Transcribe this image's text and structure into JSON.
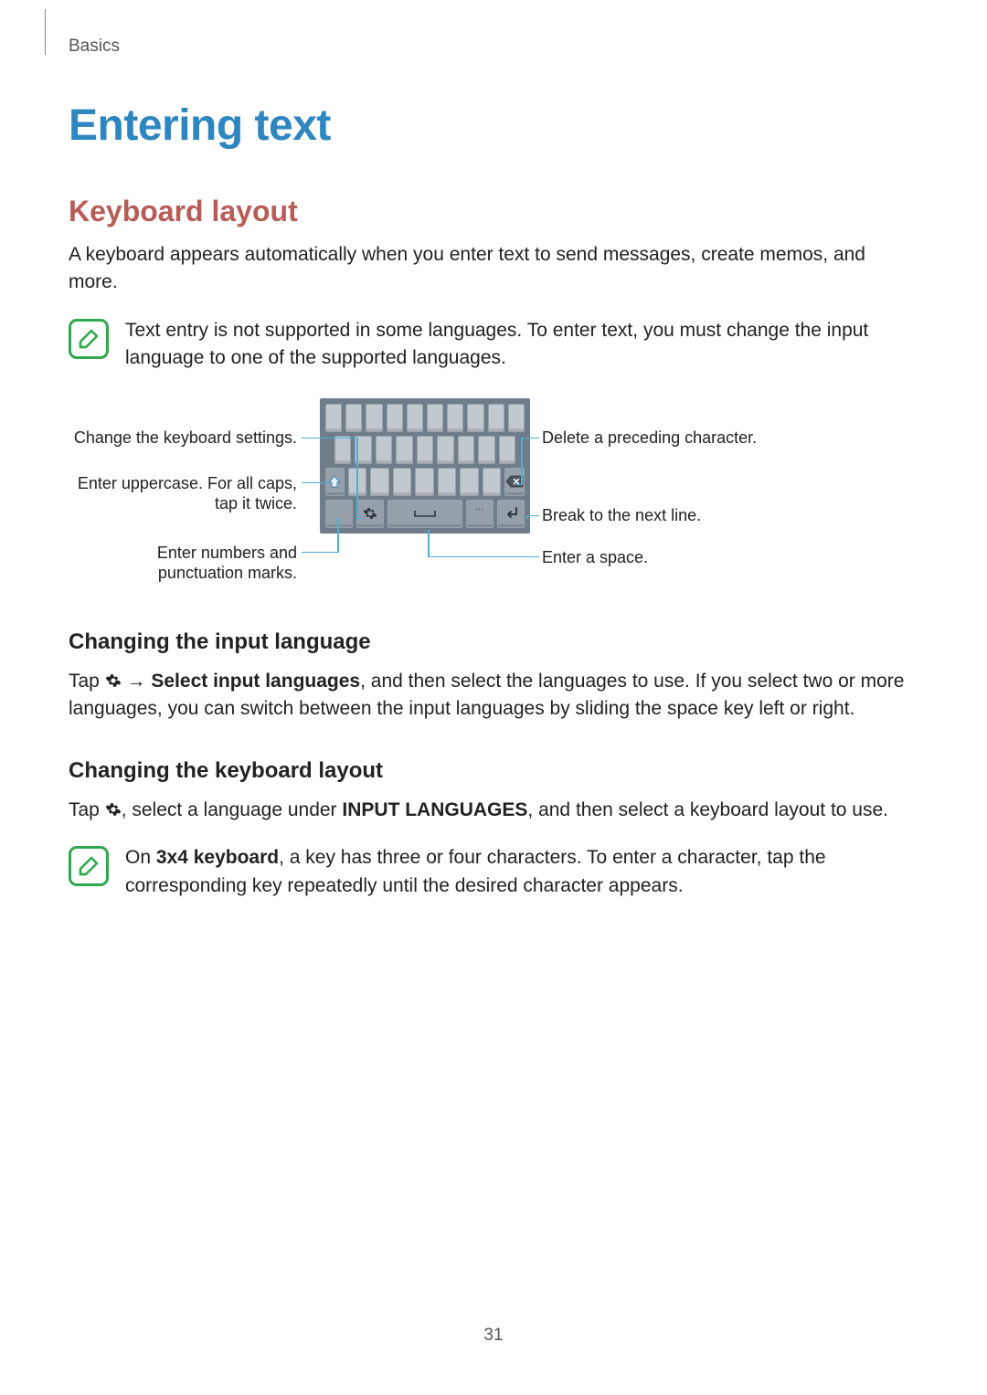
{
  "running_head": "Basics",
  "h1": "Entering text",
  "h2_kbd": "Keyboard layout",
  "p_kbd": "A keyboard appears automatically when you enter text to send messages, create memos, and more.",
  "note1": "Text entry is not supported in some languages. To enter text, you must change the input language to one of the supported languages.",
  "callouts": {
    "settings": "Change the keyboard settings.",
    "uppercase": "Enter uppercase. For all caps, tap it twice.",
    "numbers": "Enter numbers and punctuation marks.",
    "delete": "Delete a preceding character.",
    "newline": "Break to the next line.",
    "space": "Enter a space."
  },
  "h3_lang": "Changing the input language",
  "p_lang_pre": "Tap ",
  "p_lang_arrow": " → ",
  "p_lang_bold": "Select input languages",
  "p_lang_post": ", and then select the languages to use. If you select two or more languages, you can switch between the input languages by sliding the space key left or right.",
  "h3_layout": "Changing the keyboard layout",
  "p_layout_pre": "Tap ",
  "p_layout_mid": ", select a language under ",
  "p_layout_bold": "INPUT LANGUAGES",
  "p_layout_post": ", and then select a keyboard layout to use.",
  "note2_pre": "On ",
  "note2_bold": "3x4 keyboard",
  "note2_post": ", a key has three or four characters. To enter a character, tap the corresponding key repeatedly until the desired character appears.",
  "page_number": "31"
}
